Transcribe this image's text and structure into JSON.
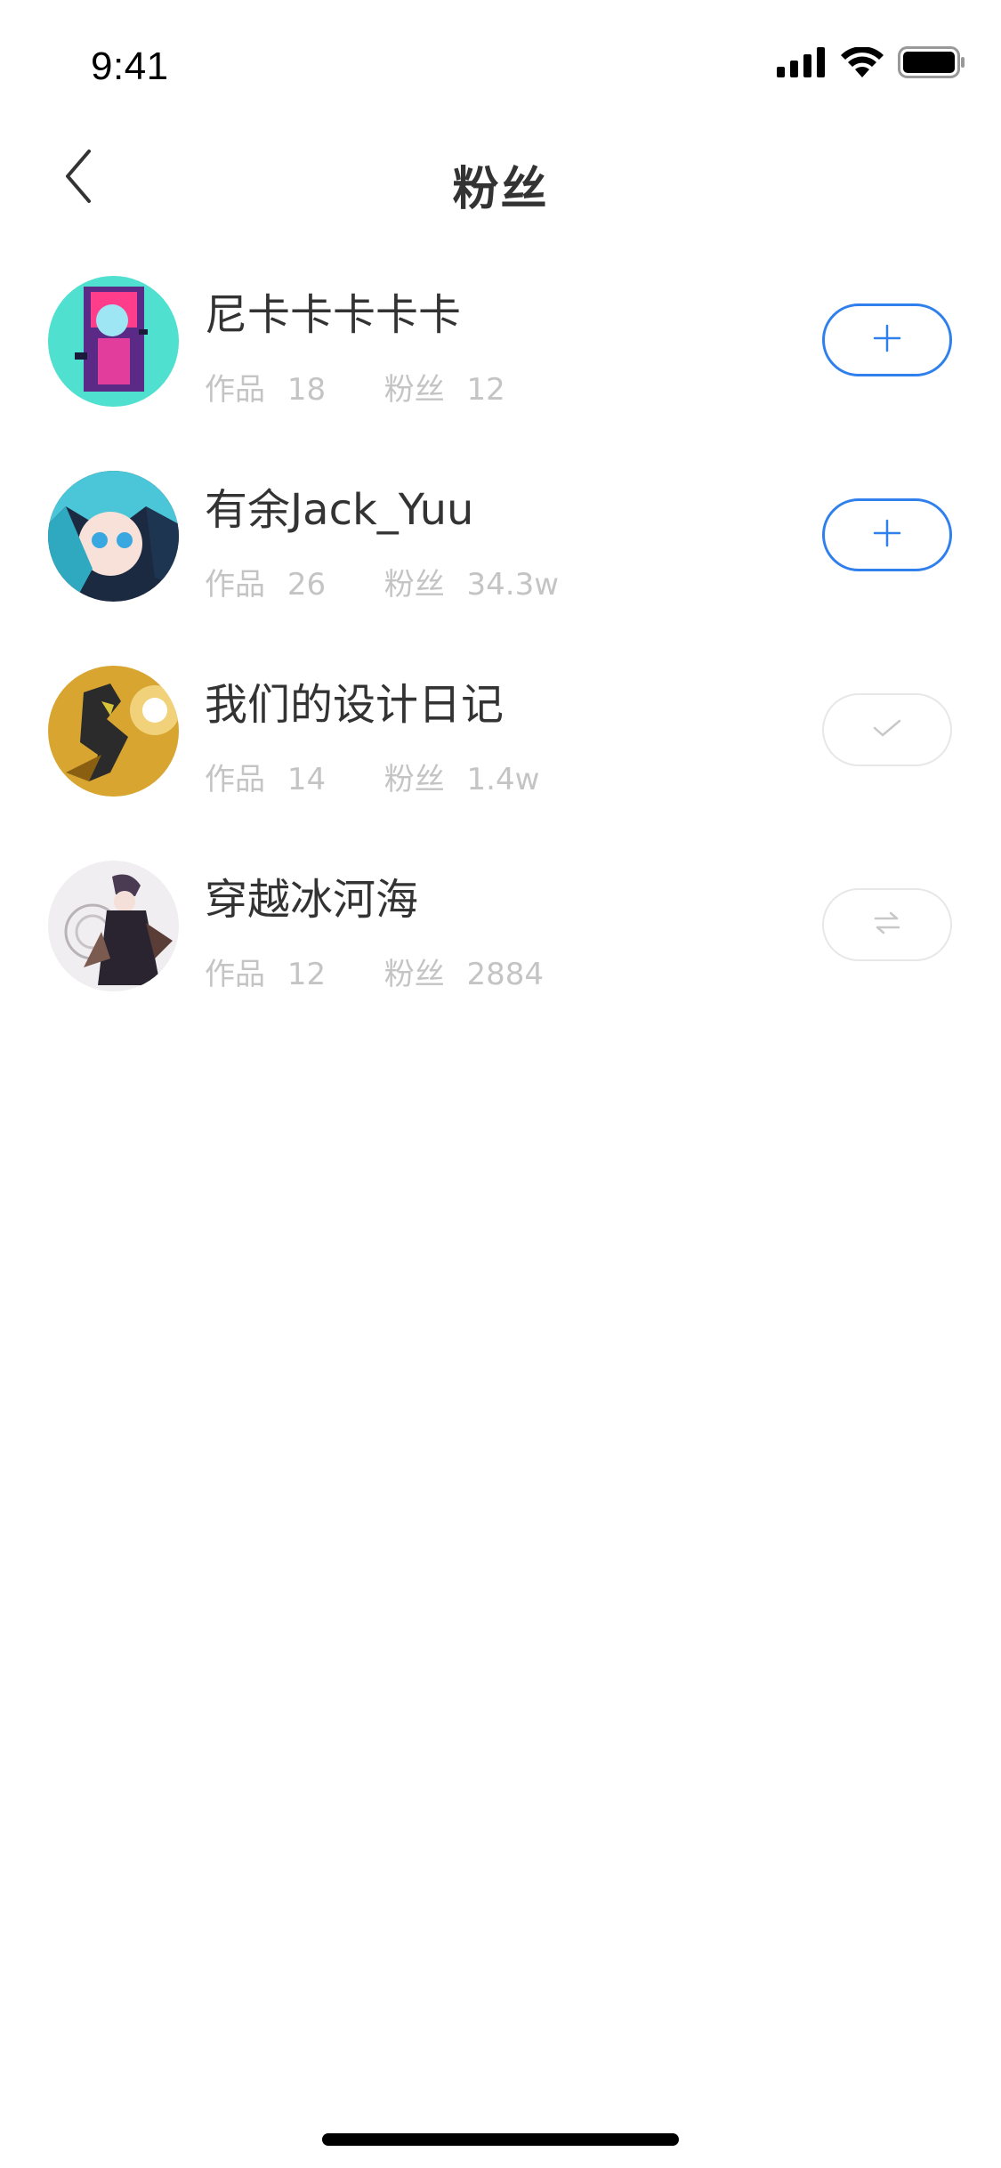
{
  "status_bar": {
    "time": "9:41"
  },
  "nav": {
    "title": "粉丝"
  },
  "fans": [
    {
      "name": "尼卡卡卡卡卡",
      "works_label": "作品",
      "works": "18",
      "fans_label": "粉丝",
      "fans": "12",
      "action": "follow",
      "action_icon": "plus-icon"
    },
    {
      "name": "有余Jack_Yuu",
      "works_label": "作品",
      "works": "26",
      "fans_label": "粉丝",
      "fans": "34.3w",
      "action": "follow",
      "action_icon": "plus-icon"
    },
    {
      "name": "我们的设计日记",
      "works_label": "作品",
      "works": "14",
      "fans_label": "粉丝",
      "fans": "1.4w",
      "action": "following",
      "action_icon": "check-icon"
    },
    {
      "name": "穿越冰河海",
      "works_label": "作品",
      "works": "12",
      "fans_label": "粉丝",
      "fans": "2884",
      "action": "mutual",
      "action_icon": "mutual-follow-icon"
    }
  ],
  "colors": {
    "accent": "#2f80ed",
    "muted": "#c4c4c4",
    "text": "#333333"
  }
}
